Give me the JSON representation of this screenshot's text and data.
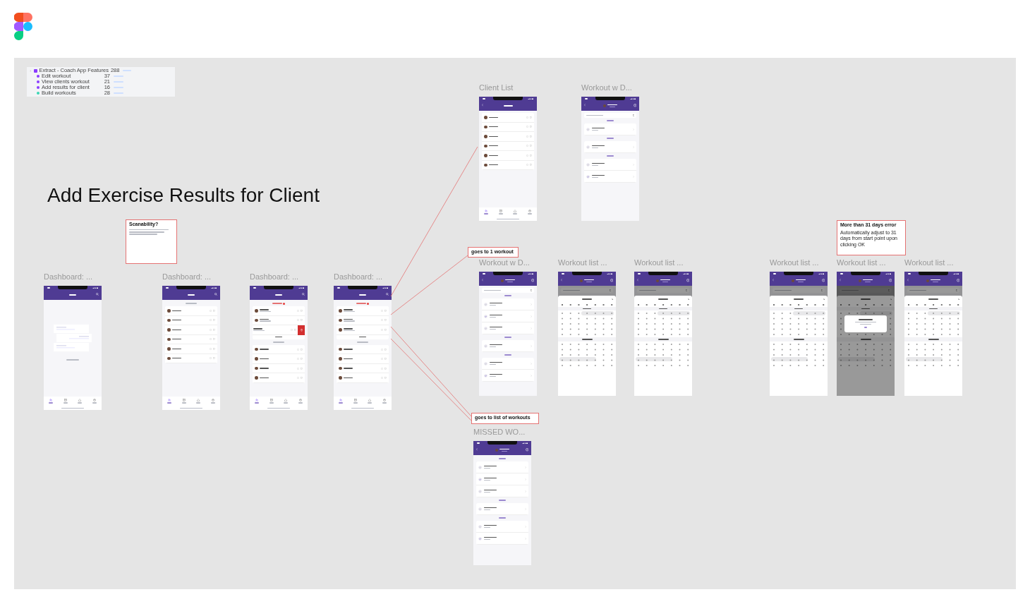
{
  "layers": [
    {
      "label": "Extract - Coach App Features",
      "count": "288",
      "color": "#8b3dff",
      "top": true
    },
    {
      "label": "Edit workout",
      "count": "37",
      "color": "#8b3dff",
      "top": false
    },
    {
      "label": "View clients workout",
      "count": "21",
      "color": "#8b3dff",
      "top": false
    },
    {
      "label": "Add results for client",
      "count": "16",
      "color": "#8b3dff",
      "top": false
    },
    {
      "label": "Build workouts",
      "count": "28",
      "color": "#3dd6b5",
      "top": false
    }
  ],
  "heading": "Add Exercise Results for Client",
  "notes": [
    {
      "title": "Scanability?",
      "body": true
    },
    {
      "title": "goes to 1 workout",
      "body": false
    },
    {
      "title": "goes to list of workouts",
      "body": false
    },
    {
      "title": "More than 31 days error",
      "text": "Automatically adjust to 31 days from start point upon clicking OK",
      "body": false
    }
  ],
  "frames": [
    {
      "title": "Dashboard: ...",
      "header": {
        "kind": "clients"
      },
      "kind": "empty",
      "tabs": [
        {
          "selected": true
        },
        {
          "selected": false
        },
        {
          "selected": false
        },
        {
          "selected": false
        }
      ]
    },
    {
      "title": "Dashboard: ...",
      "header": {
        "kind": "clients"
      },
      "kind": "list",
      "sections": [
        {
          "kind": "plain",
          "items": [
            {
              "kind": "client"
            },
            {
              "kind": "client"
            },
            {
              "kind": "client"
            },
            {
              "kind": "client"
            },
            {
              "kind": "client"
            },
            {
              "kind": "client"
            }
          ]
        }
      ],
      "tabs": [
        {
          "selected": true
        },
        {
          "selected": false
        },
        {
          "selected": false
        },
        {
          "selected": false
        }
      ]
    },
    {
      "title": "Dashboard: ...",
      "header": {
        "kind": "clients"
      },
      "kind": "list",
      "sections": [
        {
          "kind": "alert",
          "items": [
            {
              "kind": "client",
              "swiped": false
            },
            {
              "kind": "client",
              "swiped": false
            },
            {
              "kind": "client",
              "swiped": true
            }
          ]
        },
        {
          "kind": "plain",
          "items": [
            {
              "kind": "client"
            },
            {
              "kind": "client"
            },
            {
              "kind": "client"
            },
            {
              "kind": "client"
            }
          ]
        }
      ],
      "tabs": [
        {
          "selected": true
        },
        {
          "selected": false
        },
        {
          "selected": false
        },
        {
          "selected": false
        }
      ]
    },
    {
      "title": "Dashboard: ...",
      "header": {
        "kind": "clients"
      },
      "kind": "list",
      "sections": [
        {
          "kind": "alert",
          "items": [
            {
              "kind": "client",
              "swiped": false
            },
            {
              "kind": "client",
              "swiped": false
            },
            {
              "kind": "client",
              "swiped": false
            }
          ]
        },
        {
          "kind": "plain",
          "items": [
            {
              "kind": "client"
            },
            {
              "kind": "client"
            },
            {
              "kind": "client"
            },
            {
              "kind": "client"
            }
          ]
        }
      ],
      "tabs": [
        {
          "selected": true
        },
        {
          "selected": false
        },
        {
          "selected": false
        },
        {
          "selected": false
        }
      ]
    },
    {
      "title": "Client List",
      "header": {
        "kind": "all-clients"
      },
      "kind": "list",
      "sections": [
        {
          "kind": "none",
          "items": [
            {
              "kind": "client"
            },
            {
              "kind": "client"
            },
            {
              "kind": "client"
            },
            {
              "kind": "client"
            },
            {
              "kind": "client"
            },
            {
              "kind": "client"
            }
          ]
        }
      ],
      "tabs": [
        {
          "selected": true
        },
        {
          "selected": false
        },
        {
          "selected": false
        },
        {
          "selected": false
        }
      ]
    },
    {
      "title": "Workout w D...",
      "header": {
        "kind": "client"
      },
      "date_field": true,
      "kind": "list",
      "sections": [
        {
          "kind": "date",
          "items": [
            {
              "kind": "workout",
              "done": false
            }
          ]
        },
        {
          "kind": "date",
          "items": [
            {
              "kind": "workout",
              "done": false
            }
          ]
        },
        {
          "kind": "date",
          "items": [
            {
              "kind": "workout",
              "done": false
            },
            {
              "kind": "workout",
              "done": true
            }
          ]
        }
      ]
    },
    {
      "title": "Workout w D...",
      "header": {
        "kind": "client"
      },
      "date_field": true,
      "kind": "list",
      "sections": [
        {
          "kind": "date",
          "items": [
            {
              "kind": "workout",
              "done": false
            },
            {
              "kind": "workout",
              "done": true
            },
            {
              "kind": "workout",
              "done": false
            }
          ]
        },
        {
          "kind": "date",
          "items": [
            {
              "kind": "workout",
              "done": false
            }
          ]
        },
        {
          "kind": "date",
          "items": [
            {
              "kind": "workout",
              "done": false
            },
            {
              "kind": "workout",
              "done": true
            }
          ]
        }
      ]
    },
    {
      "title": "Workout list ...",
      "header": {
        "kind": "client"
      },
      "date_field": true,
      "kind": "calendar",
      "dialog": false
    },
    {
      "title": "Workout list ...",
      "header": {
        "kind": "client"
      },
      "date_field": true,
      "kind": "calendar",
      "dialog": false
    },
    {
      "title": "Workout list ...",
      "header": {
        "kind": "client"
      },
      "date_field": true,
      "kind": "calendar",
      "dialog": false
    },
    {
      "title": "Workout list ...",
      "header": {
        "kind": "client"
      },
      "date_field": true,
      "kind": "calendar",
      "dialog": true
    },
    {
      "title": "Workout list ...",
      "header": {
        "kind": "client"
      },
      "date_field": true,
      "kind": "calendar",
      "dialog": false
    },
    {
      "title": "MISSED WO...",
      "header": {
        "kind": "client"
      },
      "date_field": false,
      "kind": "list",
      "sections": [
        {
          "kind": "date",
          "items": [
            {
              "kind": "workout",
              "done": false
            },
            {
              "kind": "workout",
              "done": true
            },
            {
              "kind": "workout",
              "done": false
            }
          ]
        },
        {
          "kind": "date",
          "items": [
            {
              "kind": "workout",
              "done": false
            }
          ]
        },
        {
          "kind": "date",
          "items": [
            {
              "kind": "workout",
              "done": false
            },
            {
              "kind": "workout",
              "done": true
            }
          ]
        }
      ]
    }
  ]
}
